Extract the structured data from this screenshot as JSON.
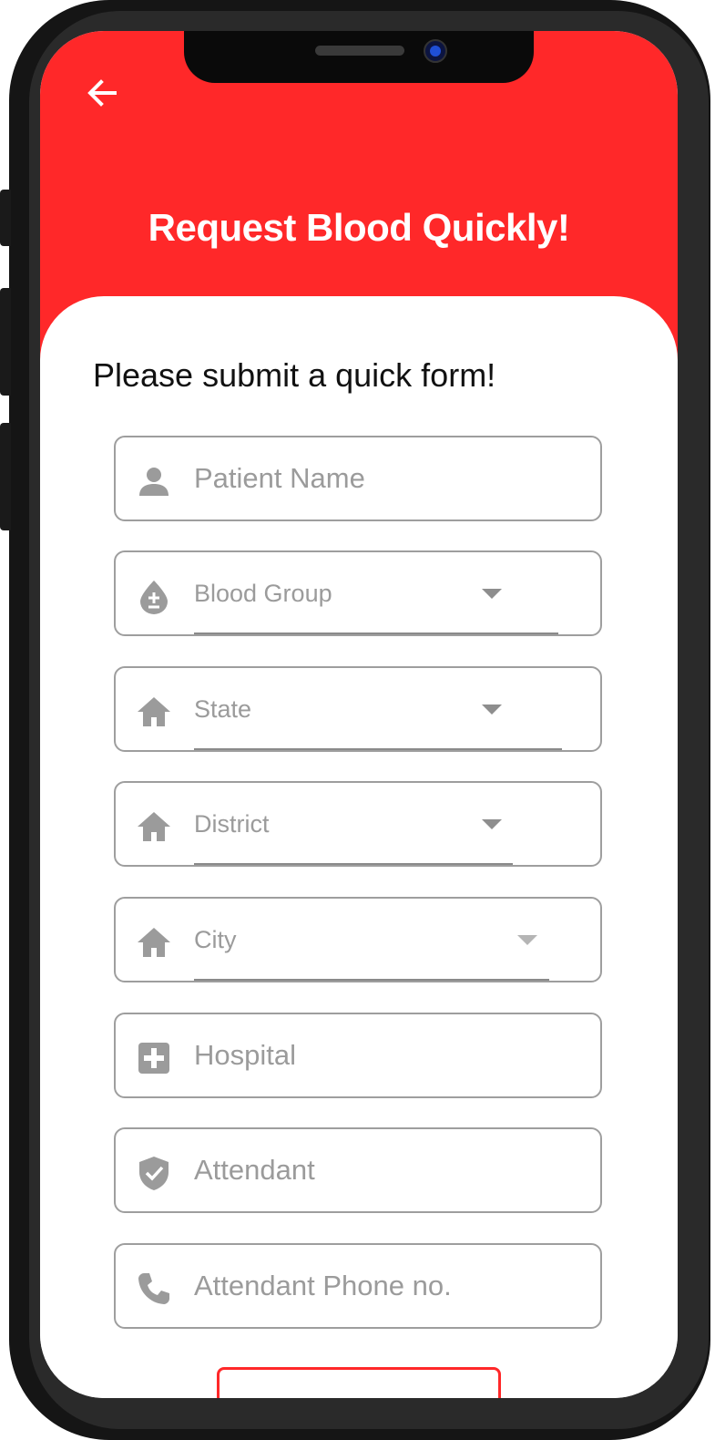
{
  "header": {
    "title": "Request Blood Quickly!",
    "back_icon": "arrow-left-icon",
    "background_color": "#ff2829"
  },
  "form": {
    "subtitle": "Please submit a quick form!",
    "fields": [
      {
        "label": "Patient Name",
        "icon": "person-icon",
        "type": "text"
      },
      {
        "label": "Blood Group",
        "icon": "blood-drop-icon",
        "type": "dropdown"
      },
      {
        "label": "State",
        "icon": "home-icon",
        "type": "dropdown"
      },
      {
        "label": "District",
        "icon": "home-icon",
        "type": "dropdown"
      },
      {
        "label": "City",
        "icon": "home-icon",
        "type": "dropdown"
      },
      {
        "label": "Hospital",
        "icon": "medical-cross-icon",
        "type": "text"
      },
      {
        "label": "Attendant",
        "icon": "shield-check-icon",
        "type": "text"
      },
      {
        "label": "Attendant Phone no.",
        "icon": "phone-icon",
        "type": "text"
      }
    ]
  },
  "colors": {
    "accent": "#ff2829",
    "field_border": "#9e9e9e",
    "placeholder": "#9b9b9b"
  }
}
